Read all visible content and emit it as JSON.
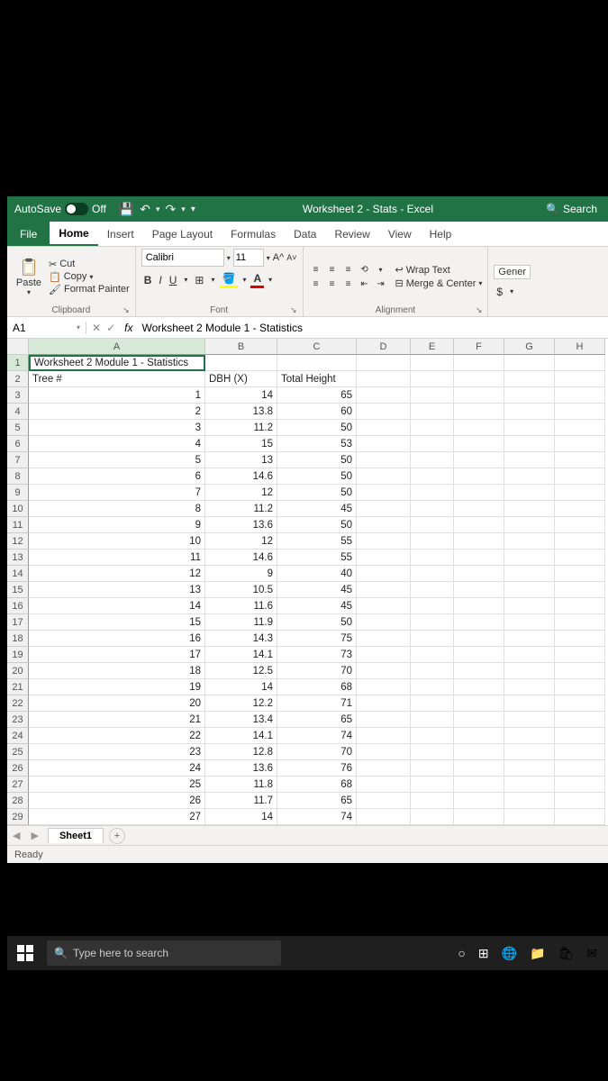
{
  "titlebar": {
    "autosave_label": "AutoSave",
    "autosave_state": "Off",
    "title": "Worksheet 2 - Stats - Excel",
    "search_label": "Search"
  },
  "tabs": {
    "file": "File",
    "home": "Home",
    "insert": "Insert",
    "page_layout": "Page Layout",
    "formulas": "Formulas",
    "data": "Data",
    "review": "Review",
    "view": "View",
    "help": "Help"
  },
  "ribbon": {
    "clipboard": {
      "paste": "Paste",
      "cut": "Cut",
      "copy": "Copy",
      "format_painter": "Format Painter",
      "label": "Clipboard"
    },
    "font": {
      "name": "Calibri",
      "size": "11",
      "label": "Font"
    },
    "alignment": {
      "wrap": "Wrap Text",
      "merge": "Merge & Center",
      "label": "Alignment"
    },
    "number": {
      "general": "Gener"
    }
  },
  "fbar": {
    "cell_ref": "A1",
    "fx": "fx",
    "formula": "Worksheet 2 Module 1 - Statistics"
  },
  "columns": [
    "A",
    "B",
    "C",
    "D",
    "E",
    "F",
    "G",
    "H"
  ],
  "rows": [
    {
      "n": 1,
      "a": "Worksheet 2 Module 1 - Statistics",
      "b": "",
      "c": ""
    },
    {
      "n": 2,
      "a": "Tree #",
      "b": "DBH (X)",
      "c": "Total Height"
    },
    {
      "n": 3,
      "a": "1",
      "b": "14",
      "c": "65"
    },
    {
      "n": 4,
      "a": "2",
      "b": "13.8",
      "c": "60"
    },
    {
      "n": 5,
      "a": "3",
      "b": "11.2",
      "c": "50"
    },
    {
      "n": 6,
      "a": "4",
      "b": "15",
      "c": "53"
    },
    {
      "n": 7,
      "a": "5",
      "b": "13",
      "c": "50"
    },
    {
      "n": 8,
      "a": "6",
      "b": "14.6",
      "c": "50"
    },
    {
      "n": 9,
      "a": "7",
      "b": "12",
      "c": "50"
    },
    {
      "n": 10,
      "a": "8",
      "b": "11.2",
      "c": "45"
    },
    {
      "n": 11,
      "a": "9",
      "b": "13.6",
      "c": "50"
    },
    {
      "n": 12,
      "a": "10",
      "b": "12",
      "c": "55"
    },
    {
      "n": 13,
      "a": "11",
      "b": "14.6",
      "c": "55"
    },
    {
      "n": 14,
      "a": "12",
      "b": "9",
      "c": "40"
    },
    {
      "n": 15,
      "a": "13",
      "b": "10.5",
      "c": "45"
    },
    {
      "n": 16,
      "a": "14",
      "b": "11.6",
      "c": "45"
    },
    {
      "n": 17,
      "a": "15",
      "b": "11.9",
      "c": "50"
    },
    {
      "n": 18,
      "a": "16",
      "b": "14.3",
      "c": "75"
    },
    {
      "n": 19,
      "a": "17",
      "b": "14.1",
      "c": "73"
    },
    {
      "n": 20,
      "a": "18",
      "b": "12.5",
      "c": "70"
    },
    {
      "n": 21,
      "a": "19",
      "b": "14",
      "c": "68"
    },
    {
      "n": 22,
      "a": "20",
      "b": "12.2",
      "c": "71"
    },
    {
      "n": 23,
      "a": "21",
      "b": "13.4",
      "c": "65"
    },
    {
      "n": 24,
      "a": "22",
      "b": "14.1",
      "c": "74"
    },
    {
      "n": 25,
      "a": "23",
      "b": "12.8",
      "c": "70"
    },
    {
      "n": 26,
      "a": "24",
      "b": "13.6",
      "c": "76"
    },
    {
      "n": 27,
      "a": "25",
      "b": "11.8",
      "c": "68"
    },
    {
      "n": 28,
      "a": "26",
      "b": "11.7",
      "c": "65"
    },
    {
      "n": 29,
      "a": "27",
      "b": "14",
      "c": "74"
    }
  ],
  "sheet": {
    "name": "Sheet1"
  },
  "status": {
    "ready": "Ready"
  },
  "taskbar": {
    "search_placeholder": "Type here to search"
  }
}
